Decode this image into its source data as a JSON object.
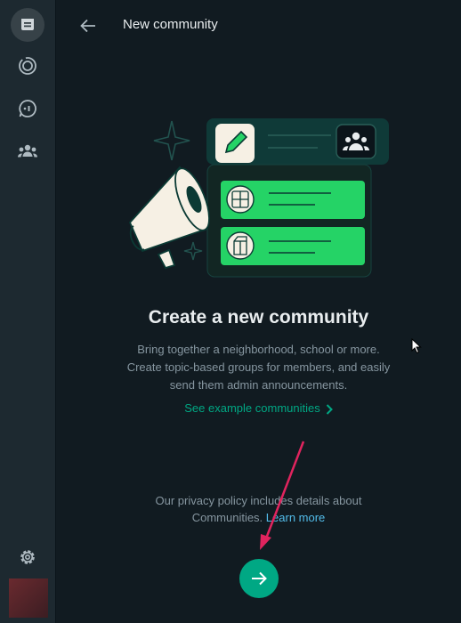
{
  "header": {
    "title": "New community"
  },
  "content": {
    "title": "Create a new community",
    "description_lines": [
      "Bring together a neighborhood, school or more.",
      "Create topic-based groups for members, and easily",
      "send them admin announcements."
    ],
    "example_link": "See example communities",
    "privacy_text": "Our privacy policy includes details about",
    "privacy_text2": "Communities.",
    "learn_more": "Learn more"
  },
  "nav": {
    "items": [
      "chats-icon",
      "status-icon",
      "channels-icon",
      "communities-icon"
    ],
    "bottom": [
      "settings-icon",
      "avatar"
    ]
  },
  "colors": {
    "accent": "#00a884",
    "link": "#53bdeb",
    "background": "#111b21",
    "rail": "#1d2930",
    "illustration_green": "#25d366",
    "annotation_arrow": "#e0245e"
  }
}
